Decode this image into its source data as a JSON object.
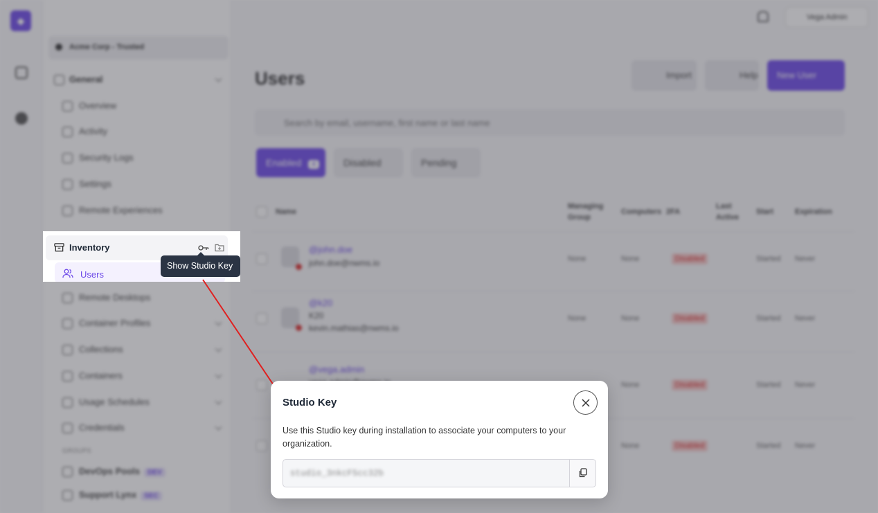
{
  "background": {
    "org_name": "Acme Corp - Trusted",
    "sidebar_general": "General",
    "sidebar_general_items": [
      "Overview",
      "Activity",
      "Security Logs",
      "Settings",
      "Remote Experiences"
    ],
    "sidebar_inventory_items": [
      "Remote Desktops",
      "Container Profiles",
      "Collections",
      "Containers",
      "Usage Schedules",
      "Credentials"
    ],
    "sidebar_section": "GROUPS",
    "groups": [
      {
        "name": "DevOps Pools",
        "badge": "DEV"
      },
      {
        "name": "Support Lynx",
        "badge": "SEC"
      }
    ],
    "account_name": "Vega Admin",
    "page_title": "Users",
    "buttons": {
      "import": "Import",
      "help": "Help",
      "new_user": "New User"
    },
    "search_placeholder": "Search by email, username, first name or last name",
    "tabs": {
      "enabled": "Enabled",
      "enabled_count": "4",
      "disabled": "Disabled",
      "pending": "Pending"
    },
    "table_headers": [
      "Name",
      "Managing Group",
      "Computers",
      "2FA",
      "Last Active",
      "Start",
      "Expiration"
    ],
    "rows": [
      {
        "name": "@john.doe",
        "email": "john.doe@nwms.io",
        "group": "None",
        "computers": "None",
        "twofa": "Disabled",
        "start": "Started",
        "expiration": "Never"
      },
      {
        "name": "@k20",
        "sub": "K20",
        "email": "kevin.mathias@nwms.io",
        "group": "None",
        "computers": "None",
        "twofa": "Disabled",
        "start": "Started",
        "expiration": "Never"
      },
      {
        "name": "@vega.admin",
        "email": "vega.admin@nwms.io",
        "group": "None",
        "computers": "None",
        "twofa": "Disabled",
        "start": "Started",
        "expiration": "Never"
      },
      {
        "name": "",
        "email": "",
        "group": "None",
        "computers": "None",
        "twofa": "Disabled",
        "start": "Started",
        "expiration": "Never"
      }
    ]
  },
  "highlight": {
    "inventory_label": "Inventory",
    "users_label": "Users",
    "tooltip": "Show Studio Key"
  },
  "modal": {
    "title": "Studio Key",
    "description": "Use this Studio key during installation to associate your computers to your organization.",
    "key_value": "studio_3nkcF5cc32b"
  },
  "colors": {
    "accent": "#6d4ae8",
    "arrow": "#e02020",
    "tooltip_bg": "#2b3444"
  }
}
